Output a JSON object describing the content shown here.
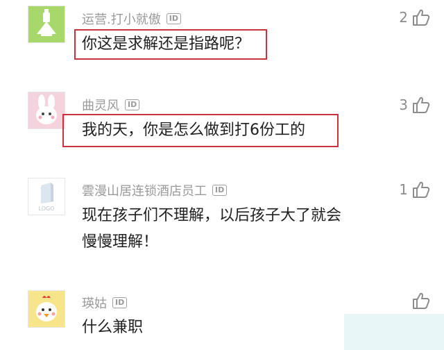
{
  "comments": [
    {
      "username": "运营.打小就傲",
      "id_badge": "ID",
      "text": "你这是求解还是指路呢？",
      "likes": "2",
      "avatar": "green-robot-avatar-icon"
    },
    {
      "username": "曲灵风",
      "id_badge": "ID",
      "text": "我的天，你是怎么做到打6份工的",
      "likes": "3",
      "avatar": "pink-rabbit-avatar-icon"
    },
    {
      "username": "雲漫山居连锁酒店员工",
      "id_badge": "ID",
      "text_line1": "现在孩子们不理解，以后孩子大了就会",
      "text_line2": "慢慢理解！",
      "likes": "1",
      "avatar": "logo-placeholder-avatar-icon",
      "avatar_text": "LOGO"
    },
    {
      "username": "瑛姑",
      "id_badge": "ID",
      "text": "什么兼职",
      "likes": "",
      "avatar": "cartoon-chicken-avatar-icon"
    }
  ],
  "colors": {
    "highlight": "#c8323c",
    "username": "#9a9a9a",
    "text": "#1f1f1f",
    "like": "#8c8c8c"
  },
  "icons": {
    "like": "thumbs-up-icon"
  }
}
